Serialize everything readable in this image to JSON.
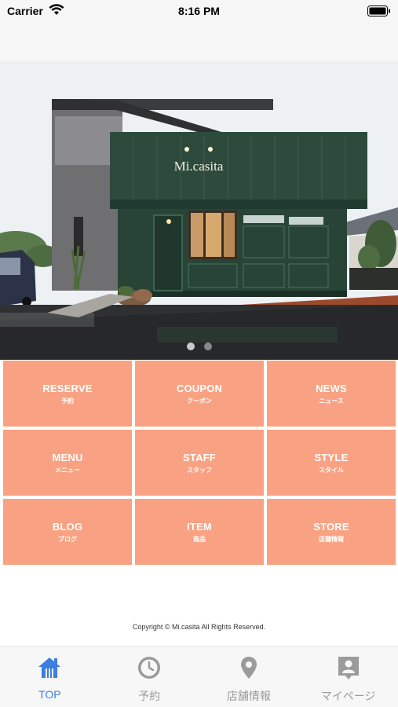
{
  "status": {
    "carrier": "Carrier",
    "time": "8:16 PM"
  },
  "hero": {
    "sign_text": "Mi.casita",
    "slides": [
      "slide-1",
      "slide-2"
    ],
    "active_slide": 1
  },
  "menu": [
    {
      "en": "RESERVE",
      "jp": "予約"
    },
    {
      "en": "COUPON",
      "jp": "クーポン"
    },
    {
      "en": "NEWS",
      "jp": "ニュース"
    },
    {
      "en": "MENU",
      "jp": "メニュー"
    },
    {
      "en": "STAFF",
      "jp": "スタッフ"
    },
    {
      "en": "STYLE",
      "jp": "スタイル"
    },
    {
      "en": "BLOG",
      "jp": "ブログ"
    },
    {
      "en": "ITEM",
      "jp": "商品"
    },
    {
      "en": "STORE",
      "jp": "店舗情報"
    }
  ],
  "copyright": "Copyright © Mi.casita All Rights Reserved.",
  "tabs": [
    {
      "label": "TOP",
      "icon": "home-icon",
      "active": true
    },
    {
      "label": "予約",
      "icon": "clock-icon",
      "active": false
    },
    {
      "label": "店舗情報",
      "icon": "map-pin-icon",
      "active": false
    },
    {
      "label": "マイページ",
      "icon": "person-badge-icon",
      "active": false
    }
  ],
  "colors": {
    "tile": "#f9a283",
    "tab_active": "#3d7ee0",
    "tab_inactive": "#9b9b9b",
    "storefront": "#2b4a3c"
  }
}
